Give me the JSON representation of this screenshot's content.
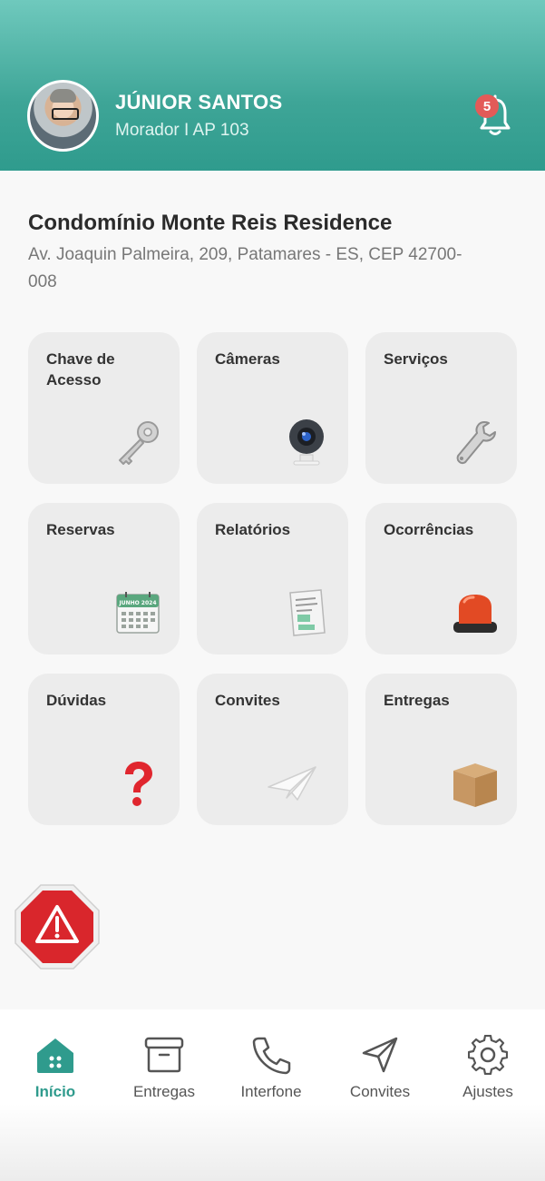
{
  "user": {
    "name": "JÚNIOR SANTOS",
    "subtitle": "Morador  I AP 103",
    "notifications": "5"
  },
  "condo": {
    "name": "Condomínio Monte Reis Residence",
    "address": "Av. Joaquin Palmeira, 209, Patamares - ES, CEP 42700-008"
  },
  "cards": [
    {
      "label": "Chave de Acesso",
      "icon": "key-icon"
    },
    {
      "label": "Câmeras",
      "icon": "camera-icon"
    },
    {
      "label": "Serviços",
      "icon": "wrench-icon"
    },
    {
      "label": "Reservas",
      "icon": "calendar-icon"
    },
    {
      "label": "Relatórios",
      "icon": "report-icon"
    },
    {
      "label": "Ocorrências",
      "icon": "siren-icon"
    },
    {
      "label": "Dúvidas",
      "icon": "question-icon"
    },
    {
      "label": "Convites",
      "icon": "paper-plane-icon"
    },
    {
      "label": "Entregas",
      "icon": "box-icon"
    }
  ],
  "calendar_text": "JUNHO 2024",
  "nav": [
    {
      "label": "Início",
      "icon": "home-icon",
      "active": true
    },
    {
      "label": "Entregas",
      "icon": "archive-icon"
    },
    {
      "label": "Interfone",
      "icon": "phone-icon"
    },
    {
      "label": "Convites",
      "icon": "send-icon"
    },
    {
      "label": "Ajustes",
      "icon": "gear-icon"
    }
  ],
  "colors": {
    "primary": "#2f9b8d",
    "header_top": "#6fc9bd",
    "badge": "#e35b58",
    "alert": "#d9262c",
    "card_bg": "#ececec"
  }
}
